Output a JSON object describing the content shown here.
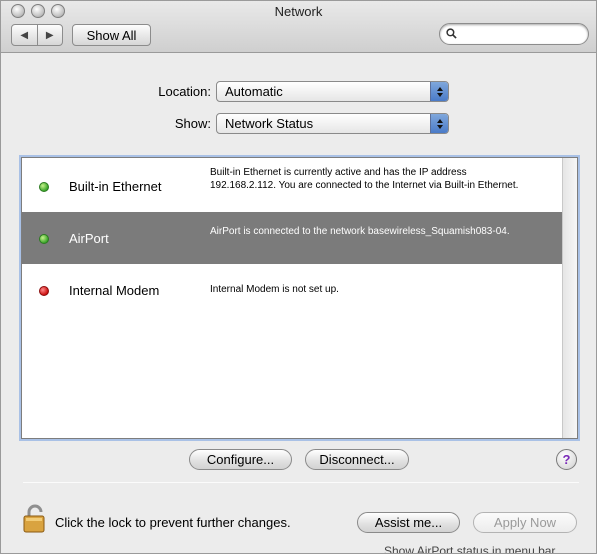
{
  "window": {
    "title": "Network",
    "show_all_label": "Show All",
    "search_placeholder": ""
  },
  "location": {
    "label": "Location:",
    "value": "Automatic"
  },
  "show": {
    "label": "Show:",
    "value": "Network Status"
  },
  "services": [
    {
      "name": "Built-in Ethernet",
      "status": "green",
      "desc": "Built-in Ethernet is currently active and has the IP address 192.168.2.112. You are connected to the Internet via Built-in Ethernet.",
      "selected": false
    },
    {
      "name": "AirPort",
      "status": "green",
      "desc": "AirPort is connected to the network basewireless_Squamish083-04.",
      "selected": true
    },
    {
      "name": "Internal Modem",
      "status": "red",
      "desc": "Internal Modem is not set up.",
      "selected": false
    }
  ],
  "buttons": {
    "configure": "Configure...",
    "disconnect": "Disconnect...",
    "help": "?",
    "assist": "Assist me...",
    "apply": "Apply Now"
  },
  "lock": {
    "text": "Click the lock to prevent further changes."
  },
  "footer_partial": "Show AirPort status in menu bar",
  "icons": {
    "back": "back-arrow-icon",
    "forward": "forward-arrow-icon",
    "search": "search-icon",
    "lock": "lock-icon",
    "status_green": "#3aa52a",
    "status_red": "#cc1010"
  }
}
